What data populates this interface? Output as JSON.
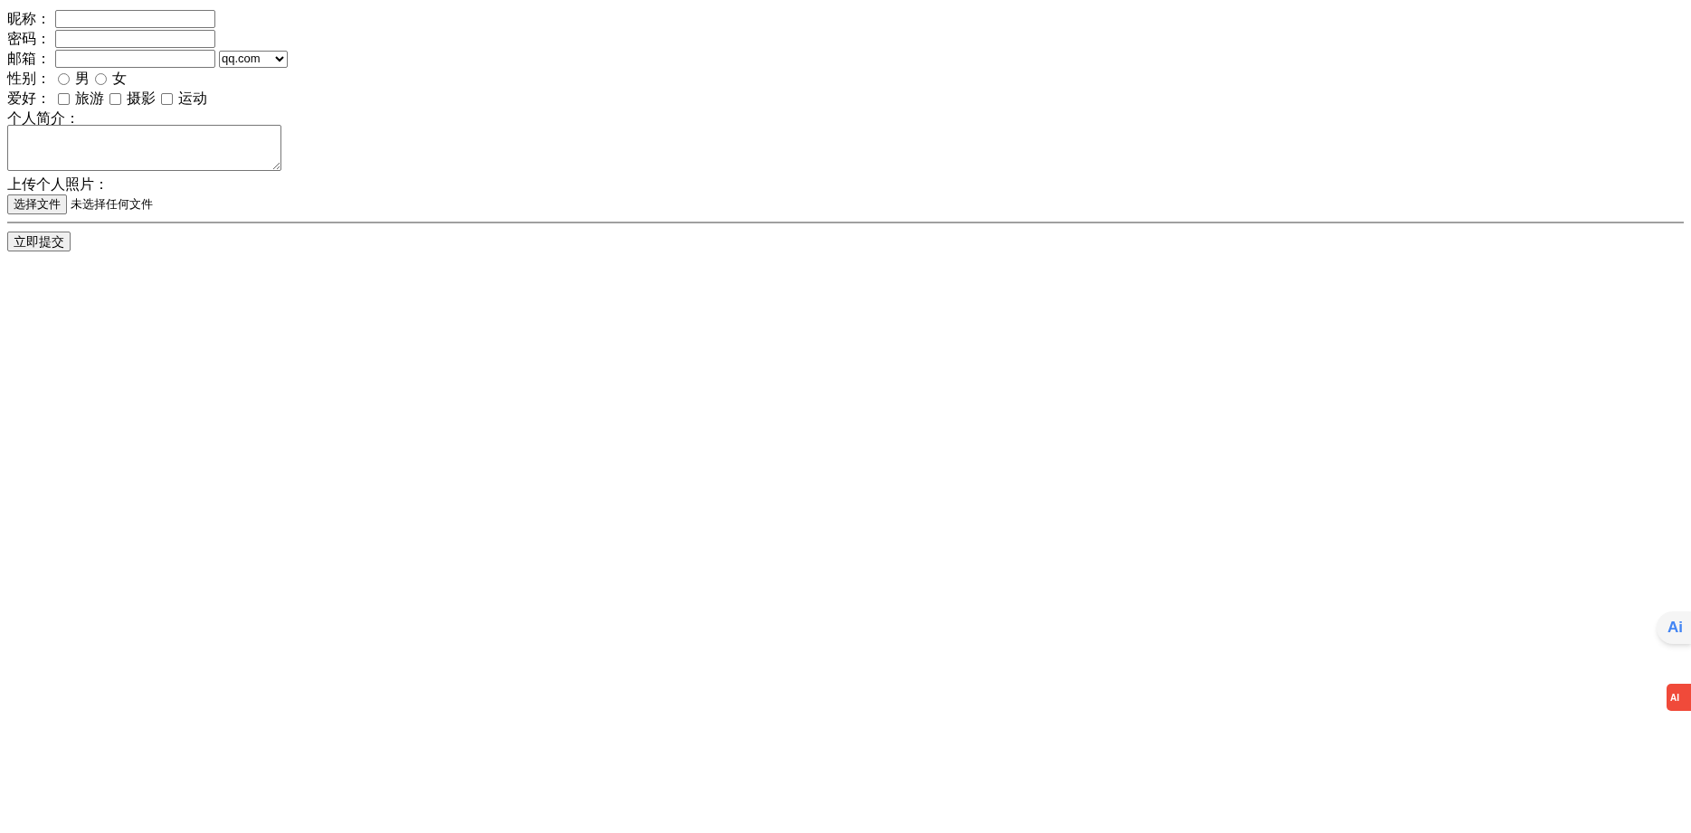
{
  "fields": [
    {
      "label": "昵称："
    },
    {
      "label": "密码："
    },
    {
      "label": "邮箱：",
      "select_value": "qq.com"
    }
  ],
  "gender": {
    "label": "性别：",
    "options": [
      {
        "label": "男",
        "checked": false
      },
      {
        "label": "女",
        "checked": false
      }
    ]
  },
  "hobbies": {
    "label": "爱好：",
    "options": [
      {
        "label": "旅游",
        "checked": false
      },
      {
        "label": "摄影",
        "checked": false
      },
      {
        "label": "运动",
        "checked": false
      }
    ]
  },
  "intro": {
    "label": "个人简介："
  },
  "upload": {
    "label": "上传个人照片：",
    "button": "选择文件",
    "status": "未选择任何文件"
  },
  "submit": "立即提交",
  "side_widgets": [
    {
      "kind": "ai_tab",
      "label": "Ai"
    },
    {
      "kind": "ai_chat",
      "label": "AI"
    }
  ]
}
